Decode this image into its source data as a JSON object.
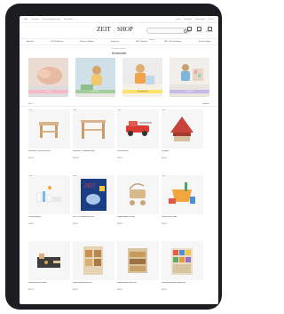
{
  "topbar": {
    "left": [
      "Hilfe",
      "Versand",
      "Geschenkgutscheine",
      "Newsletter"
    ],
    "right": [
      "Konto",
      "Merkliste",
      "Warenkorb",
      "0,00 €"
    ]
  },
  "logo": {
    "part1": "ZEIT",
    "part2": "SHOP"
  },
  "search": {
    "placeholder": "Suche"
  },
  "header_icons": [
    "Konto",
    "Merkliste",
    "Warenkorb"
  ],
  "nav": [
    "Aktuelles",
    "ZEIT Editionen",
    "Bücher & Medien",
    "Spielzeug",
    "ZEIT Produkte",
    "ZEIT Online Beilagen",
    "Geschenkideen"
  ],
  "breadcrumb": "Startseite / Kinder",
  "page_title": "Kinderwelt",
  "categories": [
    {
      "label": "Babywelt",
      "color": "#f6b8c7"
    },
    {
      "label": "Kleinkinder",
      "color": "#ffffff"
    },
    {
      "label": "Vorschulkinder",
      "color": "#ffe16b"
    },
    {
      "label": "Schulkinder",
      "color": "#c8b9e8"
    }
  ],
  "filter": {
    "left": "Filter",
    "right": "Sortieren"
  },
  "products": [
    {
      "name": "Kinderstuhl / Kindertisch Holz",
      "price": "99,00 €",
      "badge": "Neu"
    },
    {
      "name": "Kindertisch / Kinderbank Holz",
      "price": "149,00 €",
      "badge": "Neu"
    },
    {
      "name": "Feuerwehrauto",
      "price": "29,00 €",
      "badge": "Neu"
    },
    {
      "name": "Sandspiel",
      "price": "39,00 €",
      "badge": "Neu"
    },
    {
      "name": "Zahnputzspielen",
      "price": "19,90 €",
      "badge": "Neu"
    },
    {
      "name": "ZEIT LEO Kinderpuzzle Sets",
      "price": "24,95 €",
      "badge": "Neu"
    },
    {
      "name": "Puppenwagen aus Holz",
      "price": "89,00 €",
      "badge": ""
    },
    {
      "name": "Gartenset für Kinder",
      "price": "29,00 €",
      "badge": "Neu"
    },
    {
      "name": "Holzwerkzeug für Kinder",
      "price": "34,95 €",
      "badge": ""
    },
    {
      "name": "Holzbausteine Bilder-Sets",
      "price": "59,00 €",
      "badge": ""
    },
    {
      "name": "Holzbausteine Bilder-Sets",
      "price": "59,00 €",
      "badge": ""
    },
    {
      "name": "Bunte Holzbausteine Bilder-Sets",
      "price": "59,00 €",
      "badge": ""
    }
  ]
}
